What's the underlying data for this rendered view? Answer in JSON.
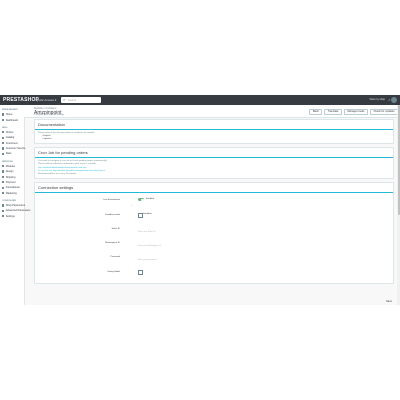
{
  "topbar": {
    "brand": "PRESTASHOP",
    "quick_access": "Quick Access ▾",
    "search_placeholder": "Search",
    "shop_link": "View my shop",
    "bell_icon": "bell-icon",
    "user_icon": "user-avatar-icon"
  },
  "sidebar": {
    "sections": [
      {
        "title": "PRESTASHOP",
        "items": [
          "Home",
          "Dashboard"
        ]
      },
      {
        "title": "SELL",
        "items": [
          "Orders",
          "Catalog",
          "Customers",
          "Customer Service",
          "Stats"
        ]
      },
      {
        "title": "IMPROVE",
        "items": [
          "Modules",
          "Design",
          "Shipping",
          "Payment",
          "International",
          "Marketing"
        ]
      },
      {
        "title": "CONFIGURE",
        "items": [
          "Shop Parameters",
          "Advanced Parameters",
          "Settings"
        ]
      }
    ]
  },
  "header": {
    "breadcrumb": "Modules / Configure",
    "title": "Amzpinpoint",
    "subtitle": "Configure your module settings",
    "toolbar": [
      "Back",
      "Translate",
      "Manage hooks",
      "Check for updates"
    ]
  },
  "panels": {
    "documentation": {
      "title": "Documentation",
      "line1": "Please refer to the documentation to configure the module:",
      "bullets": [
        "English",
        "Spanish"
      ]
    },
    "cron": {
      "title": "Cron Job for pending orders",
      "lines": [
        "You need to configure a cron job to check pending orders automatically.",
        "Please add the following command to your server's crontab:",
        "php /var/www/html/modules/amzpinpoint/cron.php",
        "Or use this url: http://localhost/modules/amzpinpoint/cron.php?token=",
        "Recommended to run every 15 minutes"
      ]
    },
    "connection": {
      "title": "Connection settings",
      "fields": [
        {
          "label": "Live Environment",
          "control": "switch",
          "value": "Enabled",
          "help": ""
        },
        {
          "label": "Sandbox mode",
          "control": "checkbox",
          "value": "Sandbox",
          "help": ""
        },
        {
          "label": "Seller ID",
          "control": "text",
          "value": "",
          "help": "Enter your Seller ID"
        },
        {
          "label": "Marketplace ID",
          "control": "text",
          "value": "",
          "help": "Enter your Marketplace ID"
        },
        {
          "label": "Password",
          "control": "text",
          "value": "",
          "help": "Enter your password"
        },
        {
          "label": "Debug Mode",
          "control": "checkbox",
          "value": "",
          "help": ""
        }
      ]
    }
  },
  "footer": {
    "save_label": "Save"
  }
}
